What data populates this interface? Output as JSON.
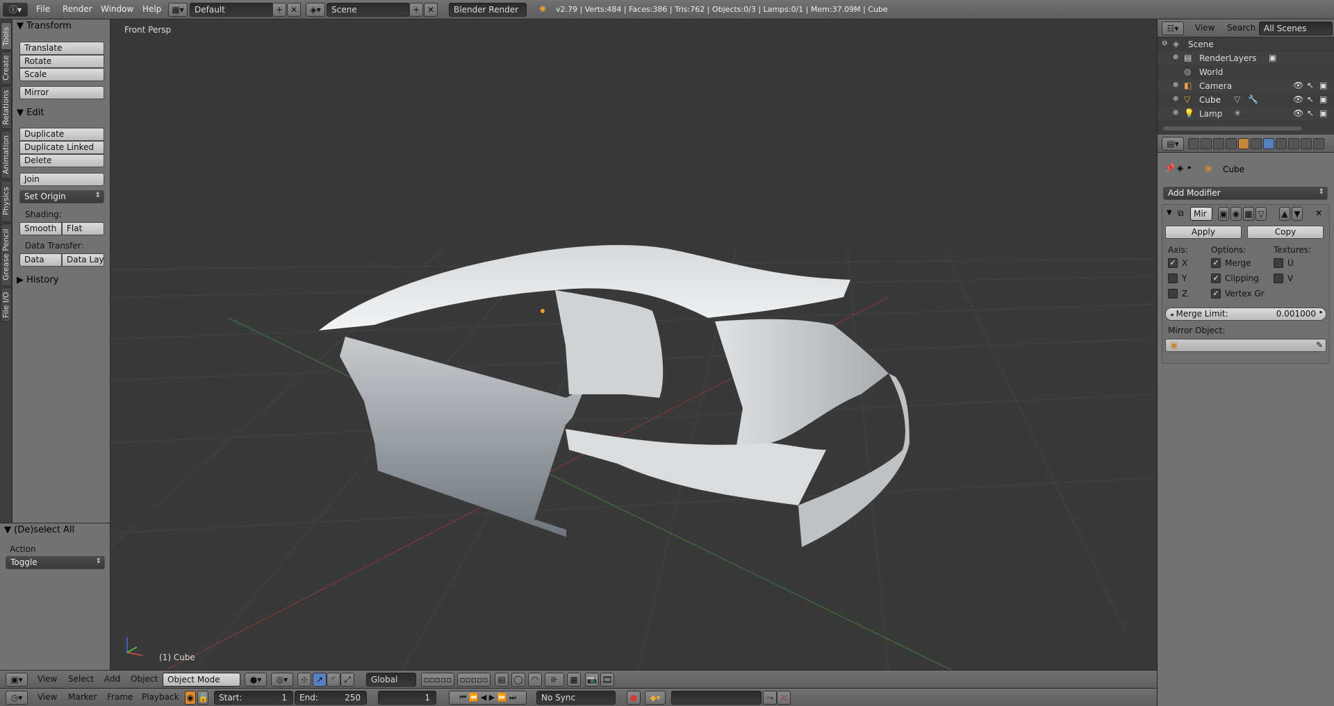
{
  "topbar": {
    "menus": [
      "File",
      "Render",
      "Window",
      "Help"
    ],
    "layout": "Default",
    "scene": "Scene",
    "engine": "Blender Render",
    "stats": "v2.79 | Verts:484 | Faces:386 | Tris:762 | Objects:0/3 | Lamps:0/1 | Mem:37.09M | Cube"
  },
  "toolshelf": {
    "tabs": [
      "Tools",
      "Create",
      "Relations",
      "Animation",
      "Physics",
      "Grease Pencil",
      "File I/O"
    ],
    "transform": {
      "title": "Transform",
      "buttons": [
        "Translate",
        "Rotate",
        "Scale",
        "Mirror"
      ]
    },
    "edit": {
      "title": "Edit",
      "buttons": [
        "Duplicate",
        "Duplicate Linked",
        "Delete",
        "Join"
      ],
      "set_origin": "Set Origin",
      "shading_label": "Shading:",
      "shading": [
        "Smooth",
        "Flat"
      ],
      "data_transfer_label": "Data Transfer:",
      "data_transfer": [
        "Data",
        "Data Layo"
      ]
    },
    "history": "History"
  },
  "operator_panel": {
    "title": "(De)select All",
    "action_label": "Action",
    "action_value": "Toggle"
  },
  "viewport": {
    "view_label": "Front Persp",
    "object_label": "(1) Cube"
  },
  "view3d_header": {
    "menus": [
      "View",
      "Select",
      "Add",
      "Object"
    ],
    "mode": "Object Mode",
    "orientation": "Global"
  },
  "timeline": {
    "menus": [
      "View",
      "Marker",
      "Frame",
      "Playback"
    ],
    "start_label": "Start:",
    "start": "1",
    "end_label": "End:",
    "end": "250",
    "current": "1",
    "sync": "No Sync"
  },
  "outliner": {
    "menus": [
      "View",
      "Search"
    ],
    "filter": "All Scenes",
    "items": [
      "Scene",
      "RenderLayers",
      "World",
      "Camera",
      "Cube",
      "Lamp"
    ]
  },
  "properties": {
    "object_name": "Cube",
    "add_modifier": "Add Modifier",
    "modifier_name": "Mir",
    "apply": "Apply",
    "copy": "Copy",
    "axis_label": "Axis:",
    "options_label": "Options:",
    "textures_label": "Textures:",
    "axes": [
      {
        "label": "X",
        "checked": true
      },
      {
        "label": "Y",
        "checked": false
      },
      {
        "label": "Z",
        "checked": false
      }
    ],
    "options": [
      {
        "label": "Merge",
        "checked": true
      },
      {
        "label": "Clipping",
        "checked": true
      },
      {
        "label": "Vertex Gr",
        "checked": true
      }
    ],
    "textures": [
      {
        "label": "U",
        "checked": false
      },
      {
        "label": "V",
        "checked": false
      }
    ],
    "merge_limit_label": "Merge Limit:",
    "merge_limit": "0.001000",
    "mirror_object_label": "Mirror Object:"
  }
}
